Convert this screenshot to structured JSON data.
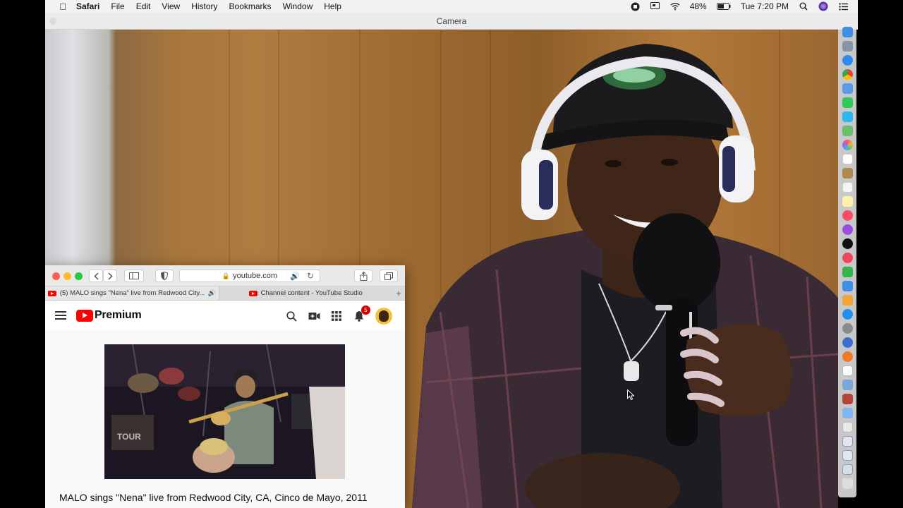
{
  "menubar": {
    "app_name": "Safari",
    "menus": [
      "File",
      "Edit",
      "View",
      "History",
      "Bookmarks",
      "Window",
      "Help"
    ],
    "battery": "48%",
    "clock": "Tue 7:20 PM"
  },
  "camera_window": {
    "title": "Camera"
  },
  "safari": {
    "url": "youtube.com",
    "tabs": [
      {
        "label": "(5) MALO sings \"Nena\" live from Redwood City...",
        "playing_audio": true
      },
      {
        "label": "Channel content - YouTube Studio",
        "playing_audio": false
      }
    ]
  },
  "youtube": {
    "logo_text": "Premium",
    "notification_count": "5",
    "video_title": "MALO sings \"Nena\" live from Redwood City, CA, Cinco de Mayo, 2011"
  },
  "colors": {
    "youtube_red": "#ff0000",
    "notification_badge": "#cc0000",
    "close_button": "#fe5f57",
    "minimize_button": "#febc2e",
    "zoom_button": "#28c840"
  }
}
